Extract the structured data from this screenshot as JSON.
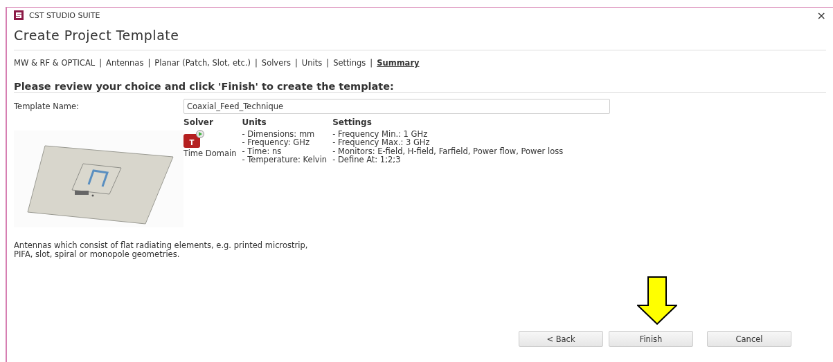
{
  "window": {
    "title": "CST STUDIO SUITE",
    "close": "×"
  },
  "heading": "Create Project Template",
  "breadcrumb": [
    {
      "kind": "step",
      "label": "MW & RF & OPTICAL",
      "selected": false
    },
    {
      "kind": "separator",
      "label": "|"
    },
    {
      "kind": "step",
      "label": "Antennas",
      "selected": false
    },
    {
      "kind": "separator",
      "label": "|"
    },
    {
      "kind": "step",
      "label": "Planar (Patch, Slot, etc.)",
      "selected": false
    },
    {
      "kind": "separator",
      "label": "|"
    },
    {
      "kind": "step",
      "label": "Solvers",
      "selected": false
    },
    {
      "kind": "separator",
      "label": "|"
    },
    {
      "kind": "step",
      "label": "Units",
      "selected": false
    },
    {
      "kind": "separator",
      "label": "|"
    },
    {
      "kind": "step",
      "label": "Settings",
      "selected": false
    },
    {
      "kind": "separator",
      "label": "|"
    },
    {
      "kind": "step",
      "label": "Summary",
      "selected": true
    }
  ],
  "instruction": "Please review your choice and click 'Finish' to create the template:",
  "template_name": {
    "label": "Template Name:",
    "value": "Coaxial_Feed_Technique"
  },
  "solver": {
    "heading": "Solver",
    "name": "Time Domain",
    "icon_letter": "T"
  },
  "units": {
    "heading": "Units",
    "items": [
      "- Dimensions: mm",
      "- Frequency: GHz",
      "- Time: ns",
      "- Temperature: Kelvin"
    ]
  },
  "settings": {
    "heading": "Settings",
    "items": [
      "- Frequency Min.: 1 GHz",
      "- Frequency Max.: 3 GHz",
      "- Monitors: E-field, H-field, Farfield, Power flow, Power loss",
      "- Define At: 1;2;3"
    ]
  },
  "description": "Antennas which consist of flat radiating elements, e.g. printed microstrip, PIFA, slot, spiral or monopole geometries.",
  "buttons": [
    "< Back",
    "Finish",
    "Cancel"
  ]
}
